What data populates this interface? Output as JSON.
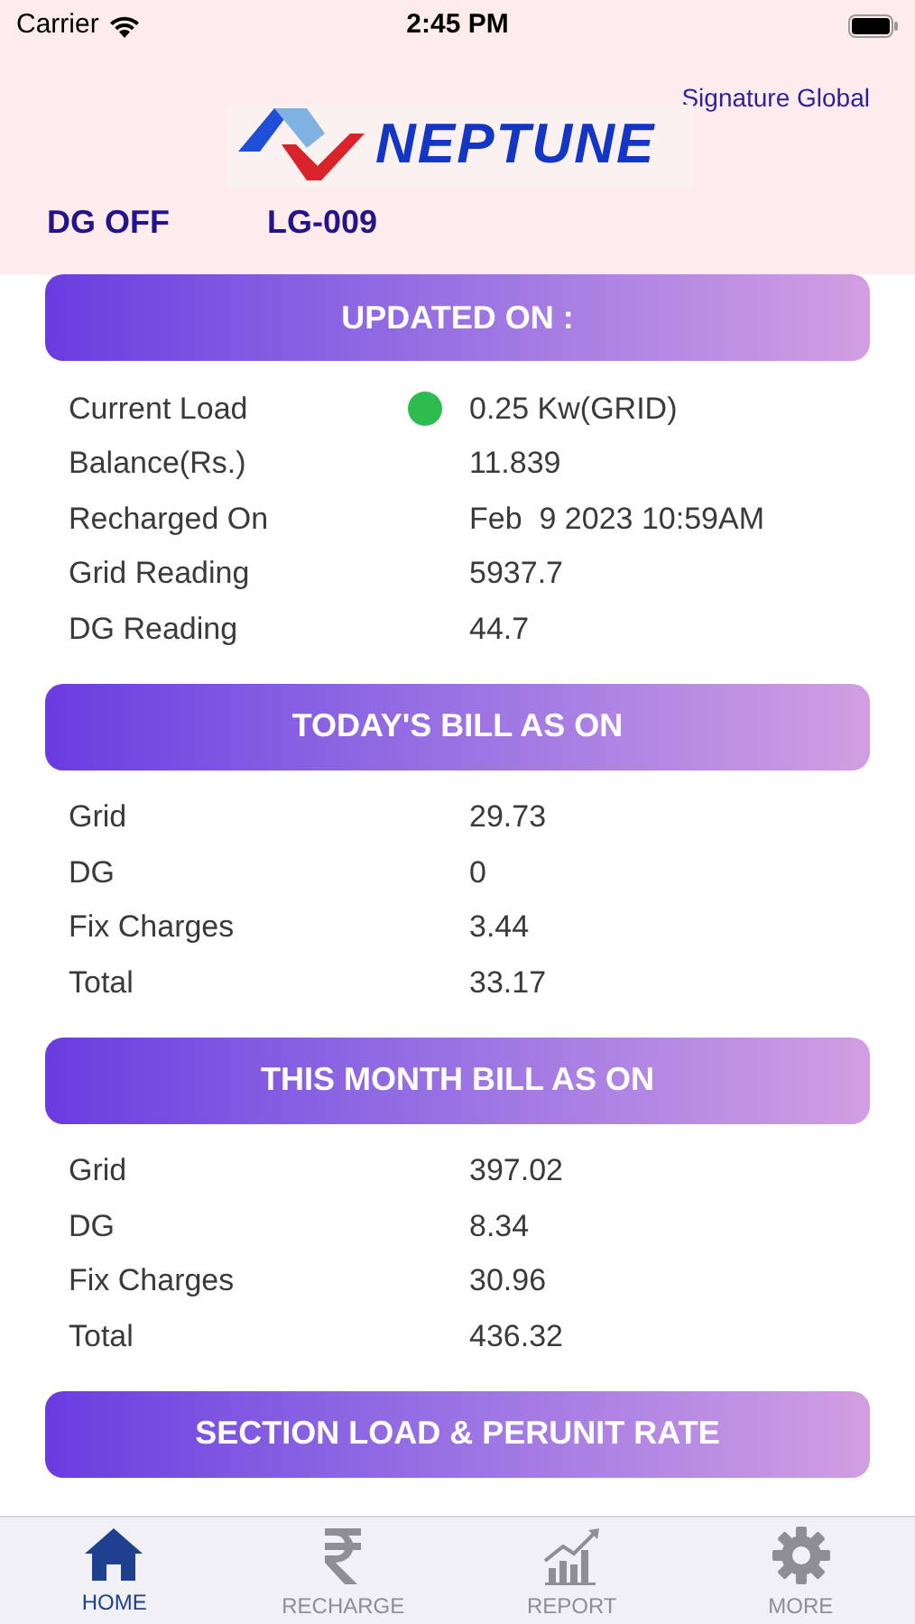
{
  "status_bar": {
    "carrier": "Carrier",
    "time": "2:45 PM"
  },
  "header": {
    "site": "Signature Global",
    "logo_text": "NEPTUNE",
    "dg_status": "DG OFF",
    "meter_id": "LG-009"
  },
  "sections": [
    {
      "title": "UPDATED ON :",
      "rows": [
        {
          "label": "Current Load",
          "value": "0.25 Kw(GRID)",
          "color": "#2dbd4e"
        },
        {
          "label": "Balance(Rs.)",
          "value": "11.839"
        },
        {
          "label": "Recharged On",
          "value": "Feb  9 2023 10:59AM"
        },
        {
          "label": "Grid Reading",
          "value": "5937.7"
        },
        {
          "label": "DG Reading",
          "value": "44.7"
        }
      ]
    },
    {
      "title": "TODAY'S BILL AS ON",
      "rows": [
        {
          "label": "Grid",
          "value": "29.73"
        },
        {
          "label": "DG",
          "value": "0"
        },
        {
          "label": "Fix Charges",
          "value": "3.44"
        },
        {
          "label": "Total",
          "value": "33.17"
        }
      ]
    },
    {
      "title": "THIS MONTH BILL AS ON",
      "rows": [
        {
          "label": "Grid",
          "value": "397.02"
        },
        {
          "label": "DG",
          "value": "8.34"
        },
        {
          "label": "Fix Charges",
          "value": "30.96"
        },
        {
          "label": "Total",
          "value": "436.32"
        }
      ]
    },
    {
      "title": "SECTION LOAD & PERUNIT RATE"
    }
  ],
  "tabs": [
    {
      "label": "HOME",
      "kind": "home",
      "selected": true
    },
    {
      "label": "RECHARGE",
      "kind": "rupee",
      "selected": false
    },
    {
      "label": "REPORT",
      "kind": "chart",
      "selected": false
    },
    {
      "label": "MORE",
      "kind": "gear",
      "selected": false
    }
  ]
}
